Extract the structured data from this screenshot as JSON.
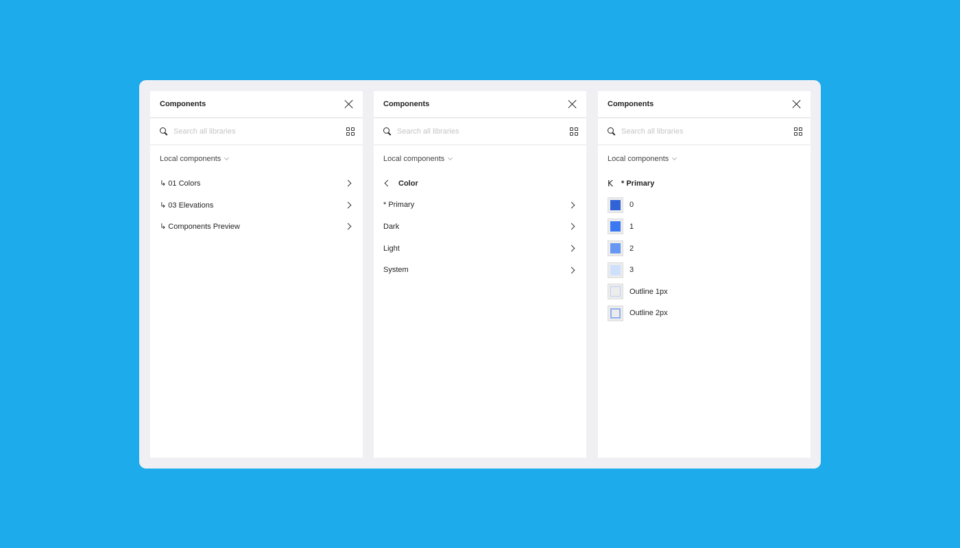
{
  "panels": [
    {
      "title": "Components",
      "search_placeholder": "Search all libraries",
      "section": "Local components",
      "items": [
        {
          "label": "↳ 01 Colors"
        },
        {
          "label": "↳ 03 Elevations"
        },
        {
          "label": "↳ Components Preview"
        }
      ]
    },
    {
      "title": "Components",
      "search_placeholder": "Search all libraries",
      "section": "Local components",
      "back_label": "Color",
      "items": [
        {
          "label": "* Primary"
        },
        {
          "label": "Dark"
        },
        {
          "label": "Light"
        },
        {
          "label": "System"
        }
      ]
    },
    {
      "title": "Components",
      "search_placeholder": "Search all libraries",
      "section": "Local components",
      "back_glyph": "K",
      "back_label": "* Primary",
      "swatches": [
        {
          "label": "0",
          "color": "#2f63d6",
          "outline": null
        },
        {
          "label": "1",
          "color": "#3b78f2",
          "outline": null
        },
        {
          "label": "2",
          "color": "#6597f3",
          "outline": null
        },
        {
          "label": "3",
          "color": "#cfe0fc",
          "outline": null
        },
        {
          "label": "Outline 1px",
          "color": "#ececec",
          "outline": "#bcd0f4"
        },
        {
          "label": "Outline 2px",
          "color": "#ececec",
          "outline": "#8fb0ee"
        }
      ]
    }
  ]
}
